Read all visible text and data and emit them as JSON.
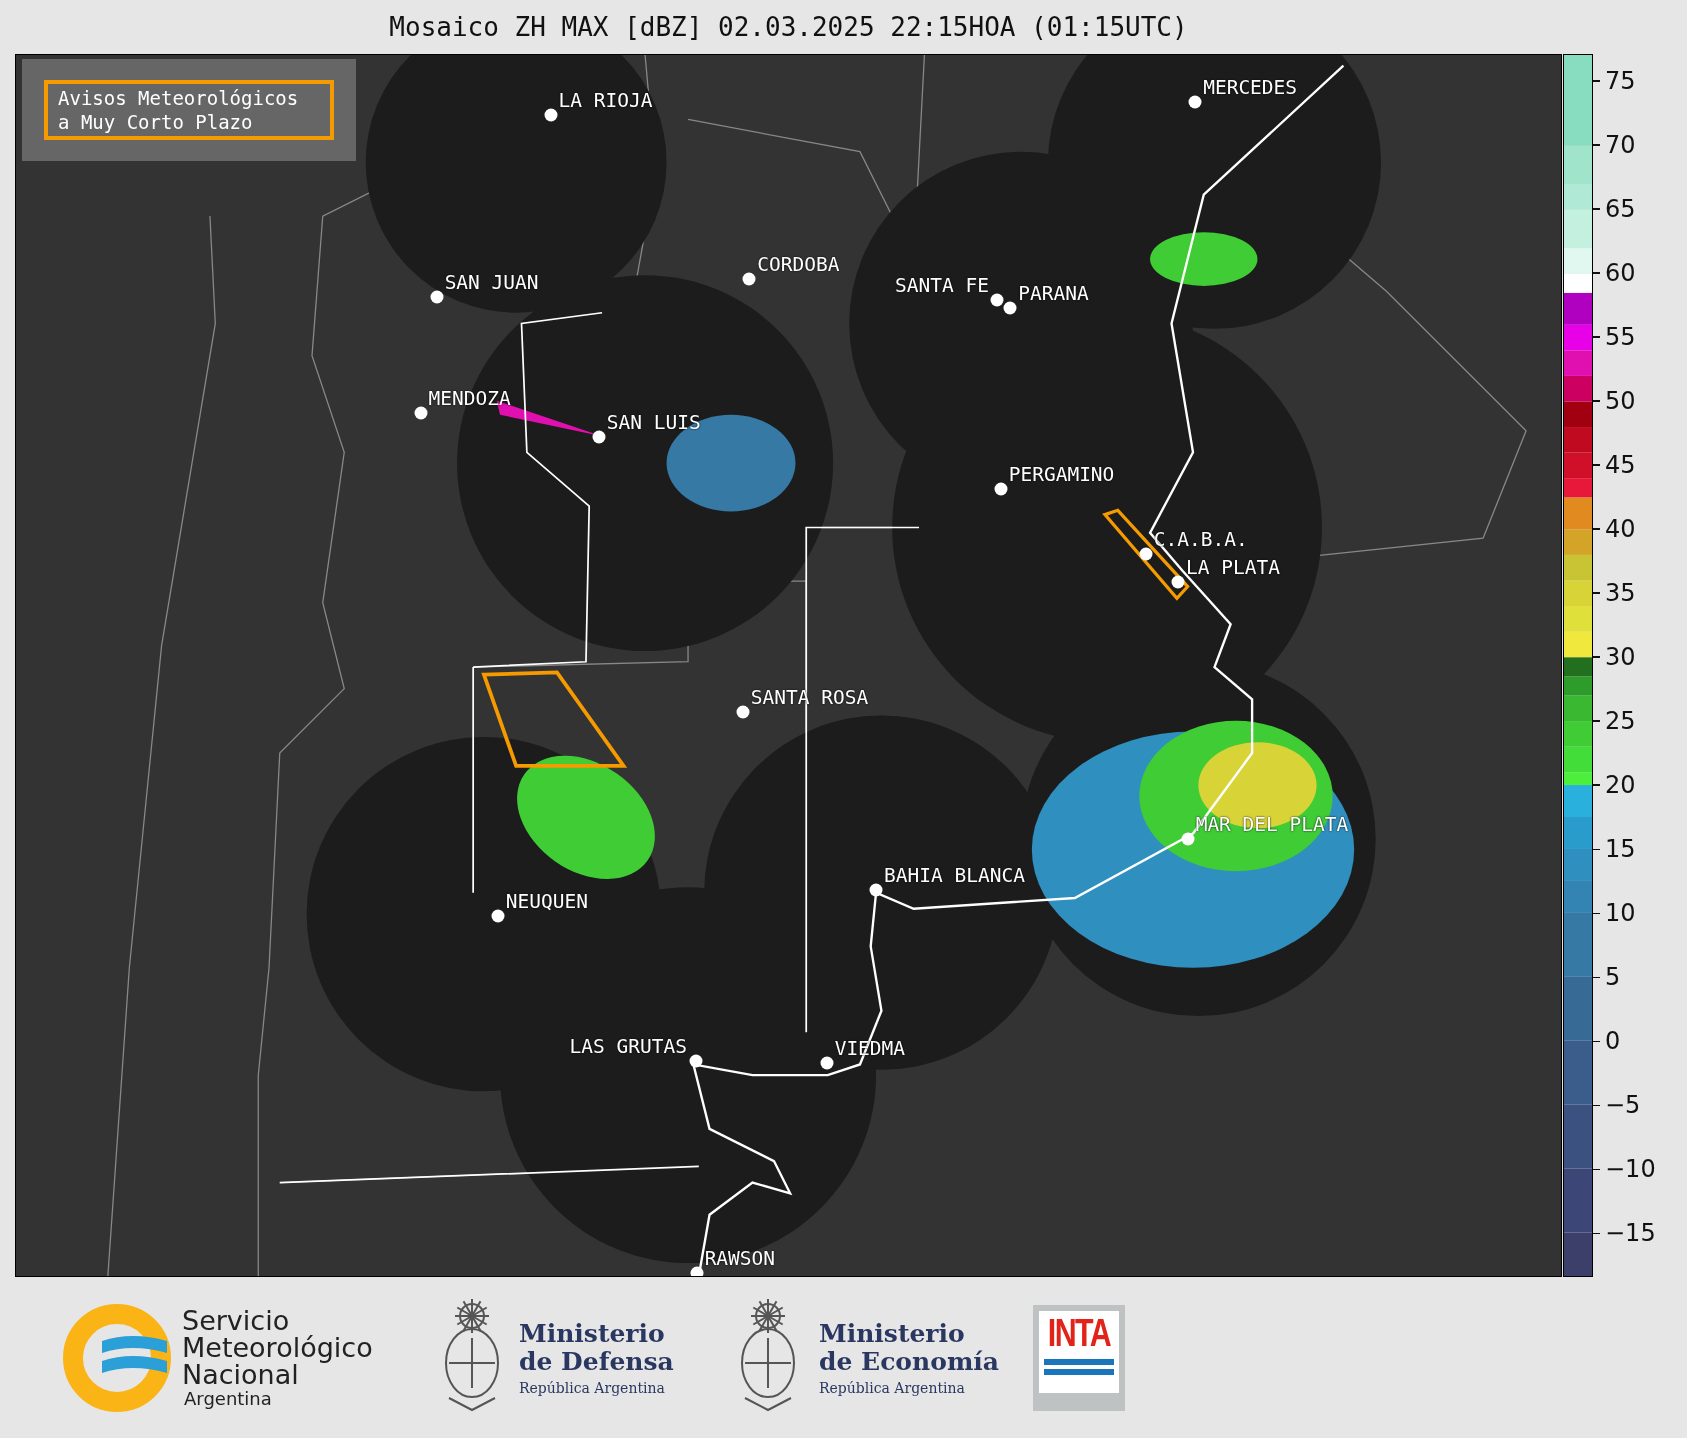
{
  "title": "Mosaico ZH MAX [dBZ] 02.03.2025 22:15HOA (01:15UTC)",
  "legend_box": {
    "lines": [
      "Avisos Meteorológicos",
      "a Muy Corto Plazo"
    ]
  },
  "cities": [
    {
      "name": "LA RIOJA"
    },
    {
      "name": "MERCEDES"
    },
    {
      "name": "CORDOBA"
    },
    {
      "name": "SAN JUAN"
    },
    {
      "name": "SANTA FE"
    },
    {
      "name": "PARANA"
    },
    {
      "name": "MENDOZA"
    },
    {
      "name": "SAN LUIS"
    },
    {
      "name": "PERGAMINO"
    },
    {
      "name": "C.A.B.A."
    },
    {
      "name": "LA PLATA"
    },
    {
      "name": "SANTA ROSA"
    },
    {
      "name": "MAR DEL PLATA"
    },
    {
      "name": "BAHIA BLANCA"
    },
    {
      "name": "NEUQUEN"
    },
    {
      "name": "LAS GRUTAS"
    },
    {
      "name": "VIEDMA"
    },
    {
      "name": "RAWSON"
    }
  ],
  "colorbar": {
    "ticks": [
      "75",
      "70",
      "65",
      "60",
      "55",
      "50",
      "45",
      "40",
      "35",
      "30",
      "25",
      "20",
      "15",
      "10",
      "5",
      "0",
      "−5",
      "−10",
      "−15"
    ]
  },
  "footer": {
    "smn": {
      "lines": [
        "Servicio",
        "Meteorológico",
        "Nacional"
      ],
      "country": "Argentina"
    },
    "ministries": [
      {
        "lines": [
          "Ministerio",
          "de Defensa"
        ],
        "sub": "República Argentina"
      },
      {
        "lines": [
          "Ministerio",
          "de Economía"
        ],
        "sub": "República Argentina"
      }
    ],
    "inta": "INTA"
  }
}
